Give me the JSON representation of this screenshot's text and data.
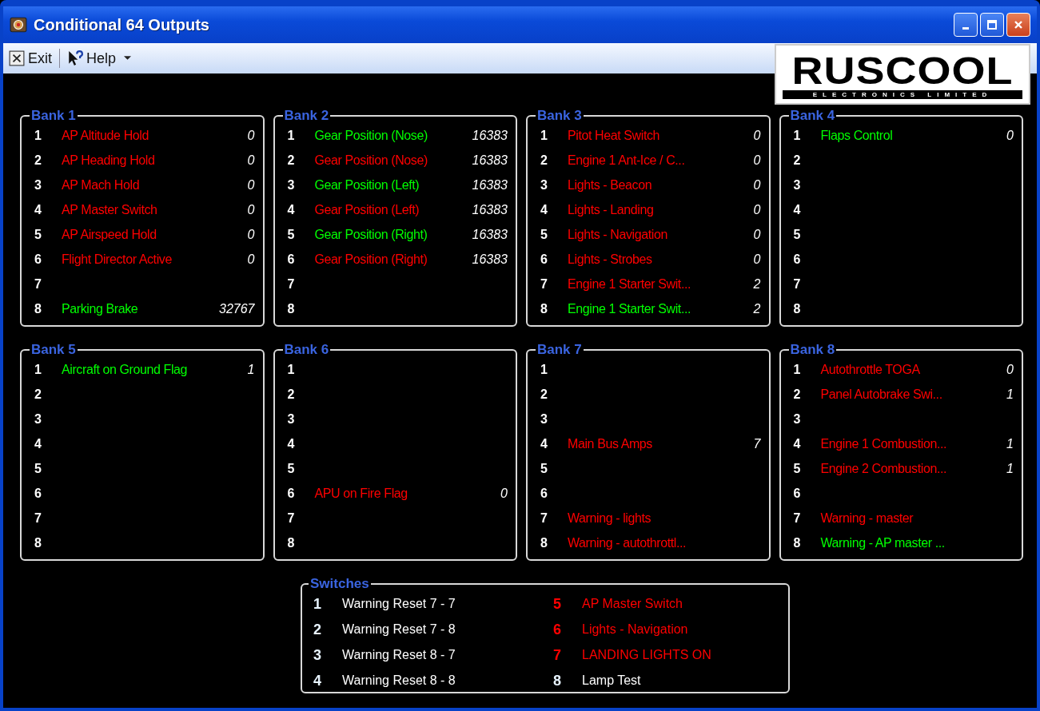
{
  "window": {
    "title": "Conditional 64 Outputs"
  },
  "menu": [
    {
      "label": "Exit",
      "kind": "exit"
    },
    {
      "label": "Help",
      "kind": "help"
    }
  ],
  "logo": {
    "name": "RUSCOOL",
    "subtitle": "ELECTRONICS LIMITED"
  },
  "banks": [
    {
      "title": "Bank 1",
      "rows": [
        {
          "number": "1",
          "label": "AP Altitude Hold",
          "value": "0",
          "color": "#ff0000"
        },
        {
          "number": "2",
          "label": "AP Heading Hold",
          "value": "0",
          "color": "#ff0000"
        },
        {
          "number": "3",
          "label": "AP Mach Hold",
          "value": "0",
          "color": "#ff0000"
        },
        {
          "number": "4",
          "label": "AP Master Switch",
          "value": "0",
          "color": "#ff0000"
        },
        {
          "number": "5",
          "label": "AP Airspeed Hold",
          "value": "0",
          "color": "#ff0000"
        },
        {
          "number": "6",
          "label": "Flight Director Active",
          "value": "0",
          "color": "#ff0000"
        },
        {
          "number": "7"
        },
        {
          "number": "8",
          "label": "Parking Brake",
          "value": "32767",
          "color": "#00ff00"
        }
      ]
    },
    {
      "title": "Bank 2",
      "rows": [
        {
          "number": "1",
          "label": "Gear Position (Nose)",
          "value": "16383",
          "color": "#00ff00"
        },
        {
          "number": "2",
          "label": "Gear Position (Nose)",
          "value": "16383",
          "color": "#ff0000"
        },
        {
          "number": "3",
          "label": "Gear Position (Left)",
          "value": "16383",
          "color": "#00ff00"
        },
        {
          "number": "4",
          "label": "Gear Position (Left)",
          "value": "16383",
          "color": "#ff0000"
        },
        {
          "number": "5",
          "label": "Gear Position (Right)",
          "value": "16383",
          "color": "#00ff00"
        },
        {
          "number": "6",
          "label": "Gear Position (Right)",
          "value": "16383",
          "color": "#ff0000"
        },
        {
          "number": "7"
        },
        {
          "number": "8"
        }
      ]
    },
    {
      "title": "Bank 3",
      "rows": [
        {
          "number": "1",
          "label": "Pitot Heat Switch",
          "value": "0",
          "color": "#ff0000"
        },
        {
          "number": "2",
          "label": "Engine 1 Ant-Ice / C...",
          "value": "0",
          "color": "#ff0000"
        },
        {
          "number": "3",
          "label": "Lights - Beacon",
          "value": "0",
          "color": "#ff0000"
        },
        {
          "number": "4",
          "label": "Lights - Landing",
          "value": "0",
          "color": "#ff0000"
        },
        {
          "number": "5",
          "label": "Lights - Navigation",
          "value": "0",
          "color": "#ff0000"
        },
        {
          "number": "6",
          "label": "Lights - Strobes",
          "value": "0",
          "color": "#ff0000"
        },
        {
          "number": "7",
          "label": "Engine 1 Starter Swit...",
          "value": "2",
          "color": "#ff0000"
        },
        {
          "number": "8",
          "label": "Engine 1 Starter Swit...",
          "value": "2",
          "color": "#00ff00"
        }
      ]
    },
    {
      "title": "Bank 4",
      "rows": [
        {
          "number": "1",
          "label": "Flaps Control",
          "value": "0",
          "color": "#00ff00"
        },
        {
          "number": "2"
        },
        {
          "number": "3"
        },
        {
          "number": "4"
        },
        {
          "number": "5"
        },
        {
          "number": "6"
        },
        {
          "number": "7"
        },
        {
          "number": "8"
        }
      ]
    },
    {
      "title": "Bank 5",
      "rows": [
        {
          "number": "1",
          "label": "Aircraft on Ground Flag",
          "value": "1",
          "color": "#00ff00"
        },
        {
          "number": "2"
        },
        {
          "number": "3"
        },
        {
          "number": "4"
        },
        {
          "number": "5"
        },
        {
          "number": "6"
        },
        {
          "number": "7"
        },
        {
          "number": "8"
        }
      ]
    },
    {
      "title": "Bank 6",
      "rows": [
        {
          "number": "1"
        },
        {
          "number": "2"
        },
        {
          "number": "3"
        },
        {
          "number": "4"
        },
        {
          "number": "5"
        },
        {
          "number": "6",
          "label": "APU on Fire Flag",
          "value": "0",
          "color": "#ff0000"
        },
        {
          "number": "7"
        },
        {
          "number": "8"
        }
      ]
    },
    {
      "title": "Bank 7",
      "rows": [
        {
          "number": "1"
        },
        {
          "number": "2"
        },
        {
          "number": "3"
        },
        {
          "number": "4",
          "label": "Main Bus Amps",
          "value": "7",
          "color": "#ff0000"
        },
        {
          "number": "5"
        },
        {
          "number": "6"
        },
        {
          "number": "7",
          "label": "Warning - lights",
          "color": "#ff0000"
        },
        {
          "number": "8",
          "label": "Warning - autothrottl...",
          "color": "#ff0000"
        }
      ]
    },
    {
      "title": "Bank 8",
      "rows": [
        {
          "number": "1",
          "label": "Autothrottle TOGA",
          "value": "0",
          "color": "#ff0000"
        },
        {
          "number": "2",
          "label": "Panel Autobrake Swi...",
          "value": "1",
          "color": "#ff0000"
        },
        {
          "number": "3"
        },
        {
          "number": "4",
          "label": "Engine 1 Combustion...",
          "value": "1",
          "color": "#ff0000"
        },
        {
          "number": "5",
          "label": "Engine 2 Combustion...",
          "value": "1",
          "color": "#ff0000"
        },
        {
          "number": "6"
        },
        {
          "number": "7",
          "label": "Warning - master",
          "color": "#ff0000"
        },
        {
          "number": "8",
          "label": "Warning - AP master ...",
          "color": "#00ff00"
        }
      ]
    }
  ],
  "switches": {
    "title": "Switches",
    "items": [
      {
        "number": "1",
        "label": "Warning Reset 7 - 7",
        "color": "#ffffff"
      },
      {
        "number": "2",
        "label": "Warning Reset 7 - 8",
        "color": "#ffffff"
      },
      {
        "number": "3",
        "label": "Warning Reset 8 - 7",
        "color": "#ffffff"
      },
      {
        "number": "4",
        "label": "Warning Reset 8 - 8",
        "color": "#ffffff"
      },
      {
        "number": "5",
        "label": "AP Master Switch",
        "color": "#ff0000"
      },
      {
        "number": "6",
        "label": "Lights - Navigation",
        "color": "#ff0000"
      },
      {
        "number": "7",
        "label": "LANDING LIGHTS ON",
        "color": "#ff0000"
      },
      {
        "number": "8",
        "label": "Lamp Test",
        "color": "#ffffff"
      }
    ]
  }
}
